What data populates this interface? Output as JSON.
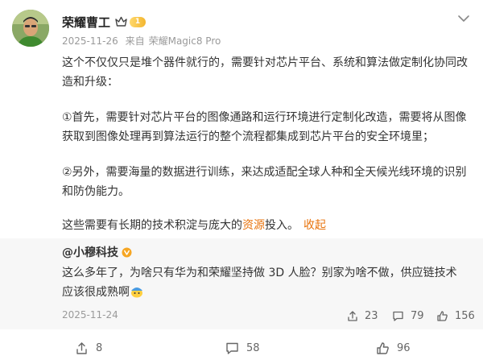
{
  "post": {
    "author": "荣耀曹工",
    "level": "1",
    "date": "2025-11-26",
    "source_prefix": "来自",
    "source_device": "荣耀Magic8 Pro",
    "paragraphs": {
      "p1": "这个不仅仅只是堆个器件就行的，需要针对芯片平台、系统和算法做定制化协同改造和升级：",
      "p2": "①首先，需要针对芯片平台的图像通路和运行环境进行定制化改造，需要将从图像获取到图像处理再到算法运行的整个流程都集成到芯片平台的安全环境里；",
      "p3": "②另外，需要海量的数据进行训练，来达成适配全球人种和全天候光线环境的识别和防伪能力。",
      "p4_before": "这些需要有长期的技术积淀与庞大的",
      "p4_link": "资源",
      "p4_after": "投入。",
      "collapse": "收起"
    }
  },
  "repost": {
    "author": "@小穆科技",
    "text": "这么多年了，为啥只有华为和荣耀坚持做 3D 人脸？别家为啥不做，供应链技术应该很成熟啊",
    "date": "2025-11-24",
    "reposts": "23",
    "comments": "79",
    "likes": "156"
  },
  "actions": {
    "reposts": "8",
    "comments": "58",
    "likes": "96"
  },
  "icons": {
    "more": "chevron-down-icon",
    "crown": "crown-icon",
    "verified": "verified-badge-icon",
    "repost": "repost-icon",
    "comment": "comment-icon",
    "like": "like-icon",
    "emoji": "emoji-face-icon"
  },
  "colors": {
    "link": "#e8730c",
    "meta": "#9a9a9a",
    "repost_bg": "#f7f7f7",
    "badge": "#f3b630"
  }
}
